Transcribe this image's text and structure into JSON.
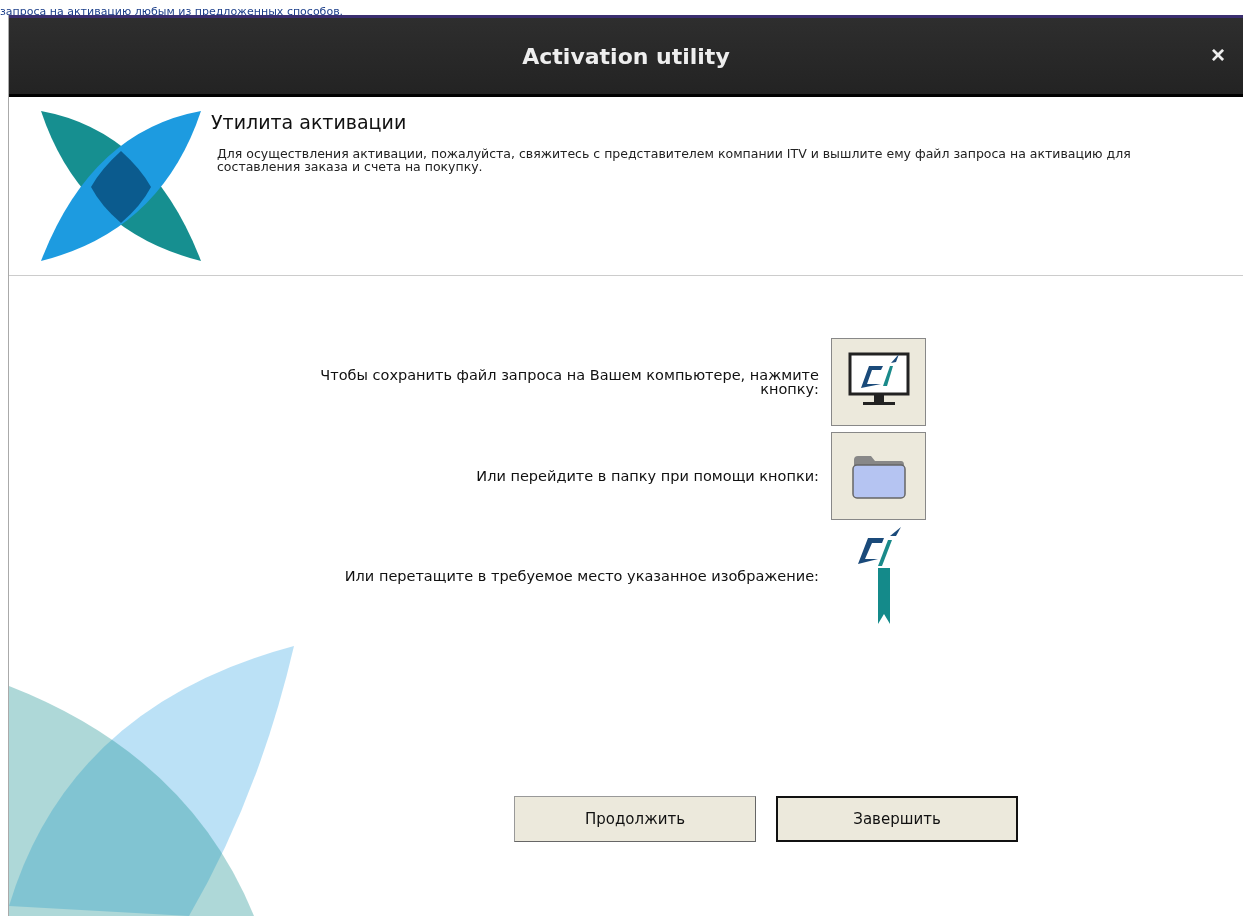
{
  "page_text": "запроса на активацию любым из предложенных способов.",
  "window": {
    "title": "Activation utility",
    "close": "×"
  },
  "header": {
    "title": "Утилита активации",
    "description": "Для осуществления активации, пожалуйста, свяжитесь с представителем компании ITV и вышлите ему файл запроса на активацию для составления заказа и счета на покупку."
  },
  "options": [
    {
      "kind": "save",
      "text": "Чтобы сохранить файл запроса на Вашем компьютере, нажмите кнопку:"
    },
    {
      "kind": "folder",
      "text": "Или перейдите в папку при помощи кнопки:"
    },
    {
      "kind": "drag",
      "text": "Или перетащите в требуемое место указанное изображение:"
    }
  ],
  "buttons": [
    {
      "label": "Продолжить",
      "default": false
    },
    {
      "label": "Завершить",
      "default": true
    }
  ]
}
